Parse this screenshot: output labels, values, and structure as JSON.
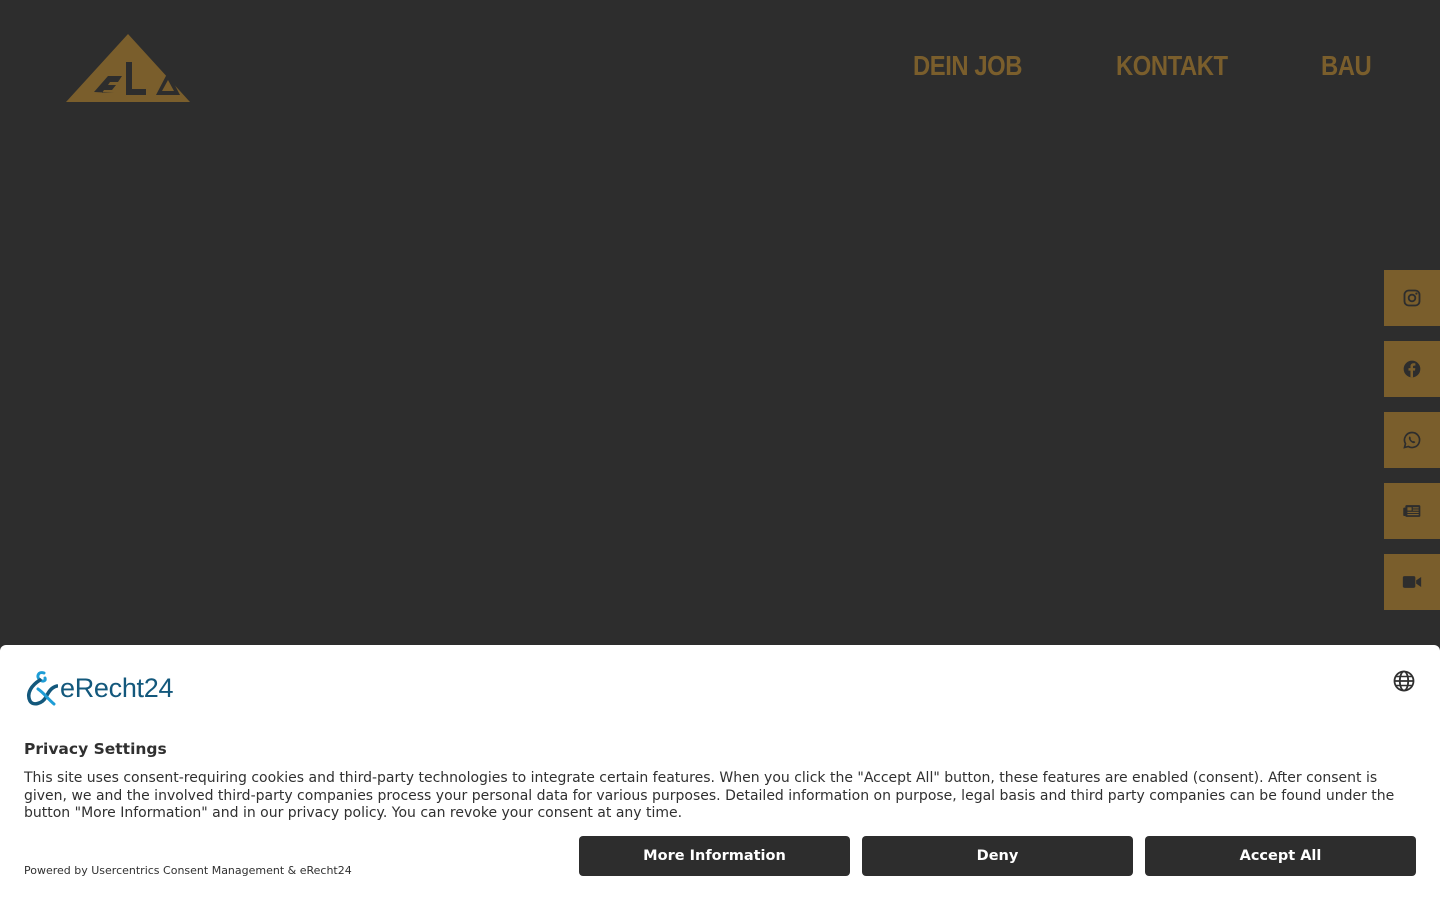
{
  "brand": {
    "accent_color": "#7a5e2c",
    "background_color": "#2d2d2d",
    "logo_icon": "ela-triangle-logo-icon"
  },
  "nav": {
    "items": [
      {
        "label": "DEIN JOB"
      },
      {
        "label": "KONTAKT"
      },
      {
        "label": "BAU"
      }
    ]
  },
  "social": {
    "items": [
      {
        "icon": "instagram-icon"
      },
      {
        "icon": "facebook-icon"
      },
      {
        "icon": "whatsapp-icon"
      },
      {
        "icon": "newspaper-icon"
      },
      {
        "icon": "video-camera-icon"
      }
    ]
  },
  "consent": {
    "brand_name": "eRecht24",
    "brand_color": "#13587c",
    "language_icon": "globe-icon",
    "title": "Privacy Settings",
    "body": "This site uses consent-requiring cookies and third-party technologies to integrate certain features. When you click the \"Accept All\" button, these features are enabled (consent). After consent is given, we and the involved third-party companies process your personal data for various purposes. Detailed information on purpose, legal basis and third party companies can be found under the button \"More Information\" and in our privacy policy. You can revoke your consent at any time.",
    "powered_by": "Powered by Usercentrics Consent Management & eRecht24",
    "buttons": {
      "more_info": "More Information",
      "deny": "Deny",
      "accept_all": "Accept All"
    }
  }
}
